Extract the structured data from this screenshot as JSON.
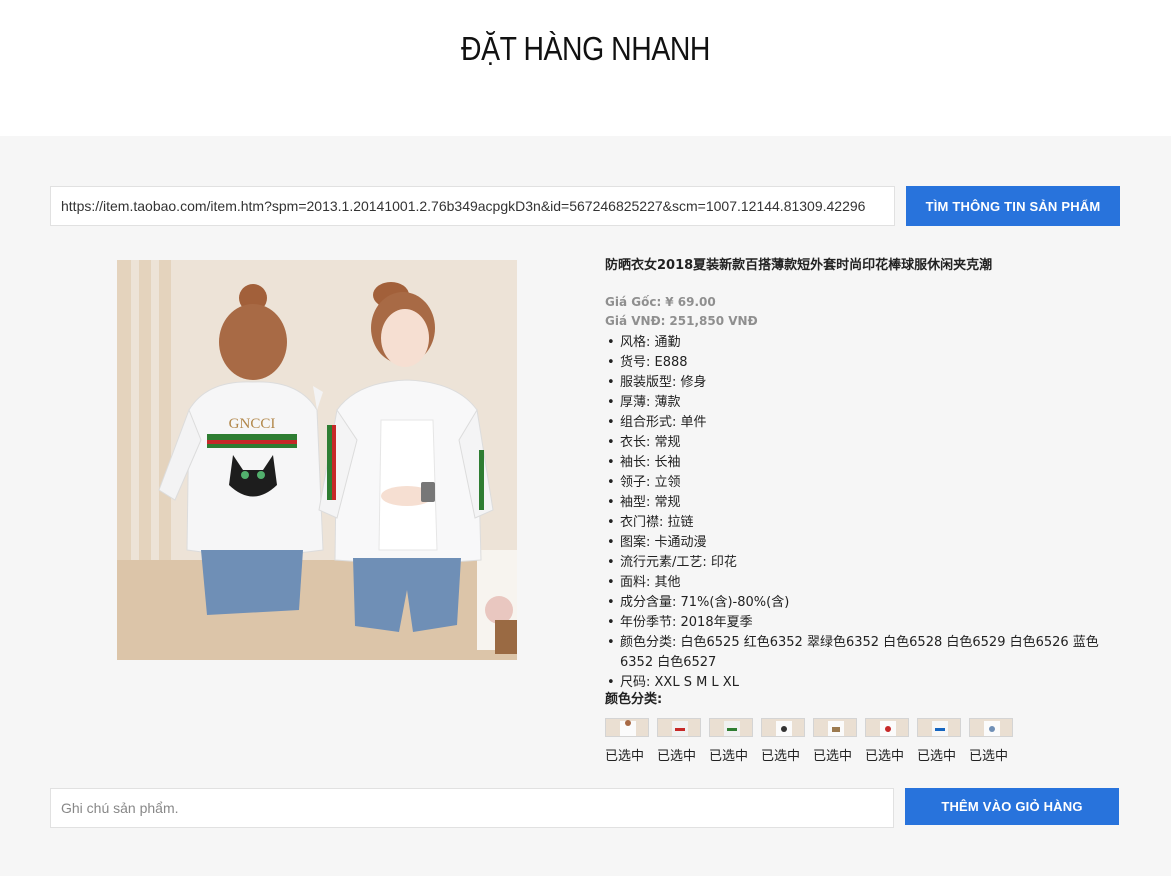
{
  "header": {
    "title": "ĐẶT HÀNG NHANH"
  },
  "search": {
    "url_value": "https://item.taobao.com/item.htm?spm=2013.1.20141001.2.76b349acpgkD3n&id=567246825227&scm=1007.12144.81309.42296",
    "button_label": "TÌM THÔNG TIN SẢN PHẨM"
  },
  "product": {
    "title": "防晒衣女2018夏装新款百搭薄款短外套时尚印花棒球服休闲夹克潮",
    "image_print_text": "GNCCI",
    "price_original_label": "Giá Gốc:",
    "price_original": "¥ 69.00",
    "price_vnd_label": "Giá VNĐ:",
    "price_vnd": "251,850 VNĐ",
    "attributes": [
      "风格: 通勤",
      "货号: E888",
      "服装版型: 修身",
      "厚薄: 薄款",
      "组合形式: 单件",
      "衣长: 常规",
      "袖长: 长袖",
      "领子: 立领",
      "袖型: 常规",
      "衣门襟: 拉链",
      "图案: 卡通动漫",
      "流行元素/工艺: 印花",
      "面料: 其他",
      "成分含量: 71%(含)-80%(含)",
      "年份季节: 2018年夏季",
      "颜色分类: 白色6525 红色6352 翠绿色6352 白色6528 白色6529 白色6526 蓝色6352 白色6527",
      "尺码: XXL S M L XL"
    ],
    "colors_label": "颜色分类:",
    "swatches": [
      "已选中",
      "已选中",
      "已选中",
      "已选中",
      "已选中",
      "已选中",
      "已选中",
      "已选中"
    ]
  },
  "note": {
    "placeholder": "Ghi chú sản phẩm."
  },
  "cart": {
    "button_label": "THÊM VÀO GIỎ HÀNG"
  },
  "colors": {
    "accent": "#2873dc",
    "page_bg": "#f6f6f6",
    "muted_text": "#8f8f8f"
  }
}
